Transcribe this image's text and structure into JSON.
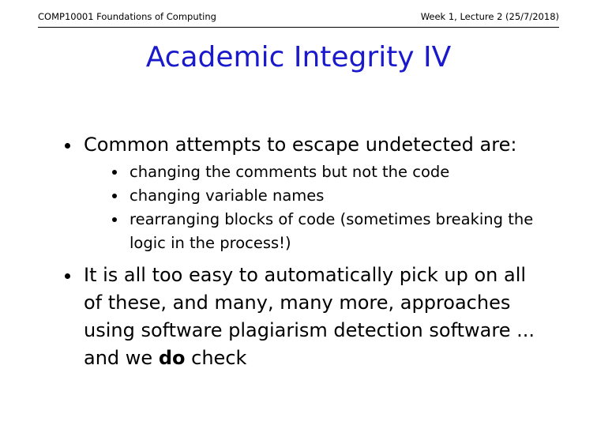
{
  "header": {
    "left": "COMP10001 Foundations of Computing",
    "right": "Week 1, Lecture 2 (25/7/2018)"
  },
  "title": "Academic Integrity IV",
  "bullets": [
    {
      "text": "Common attempts to escape undetected are:",
      "sub": [
        "changing the comments but not the code",
        "changing variable names",
        "rearranging blocks of code (sometimes breaking the logic in the process!)"
      ]
    },
    {
      "text_before": "It is all too easy to automatically pick up on all of these, and many, many more, approaches using software plagiarism detection software ... and we",
      "text_emph": "do",
      "text_after": "check"
    }
  ]
}
